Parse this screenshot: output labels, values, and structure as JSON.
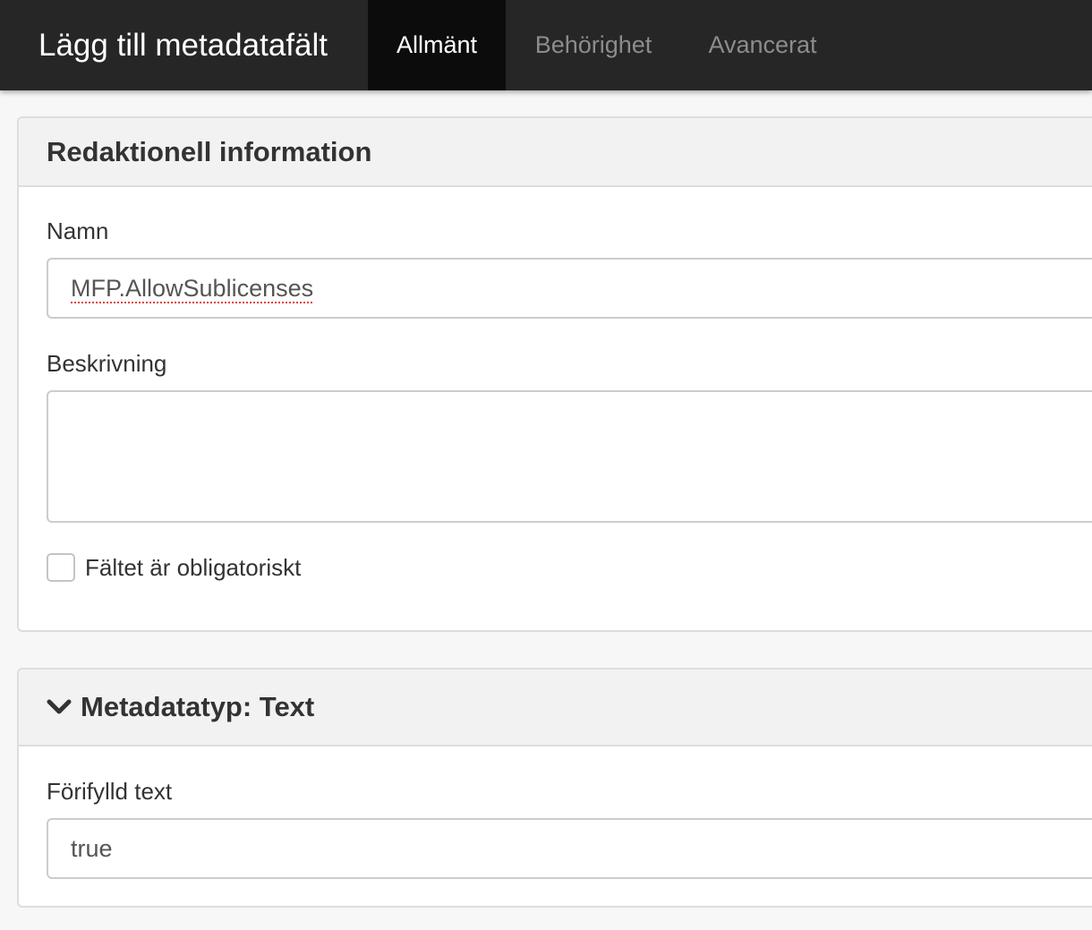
{
  "header": {
    "title": "Lägg till metadatafält",
    "tabs": [
      {
        "label": "Allmänt",
        "active": true
      },
      {
        "label": "Behörighet",
        "active": false
      },
      {
        "label": "Avancerat",
        "active": false
      }
    ]
  },
  "editorial": {
    "heading": "Redaktionell information",
    "name_label": "Namn",
    "name_value": "MFP.AllowSublicenses",
    "description_label": "Beskrivning",
    "description_value": "",
    "required_label": "Fältet är obligatoriskt",
    "required_checked": false
  },
  "metatype": {
    "heading": "Metadatatyp: Text",
    "heading_icon": "chevron-down-icon",
    "prefilled_label": "Förifylld text",
    "prefilled_value": "true"
  },
  "colors": {
    "topbar": "#262626",
    "active_tab": "#0c0c0c",
    "inactive_tab_text": "#8c8c8c"
  }
}
